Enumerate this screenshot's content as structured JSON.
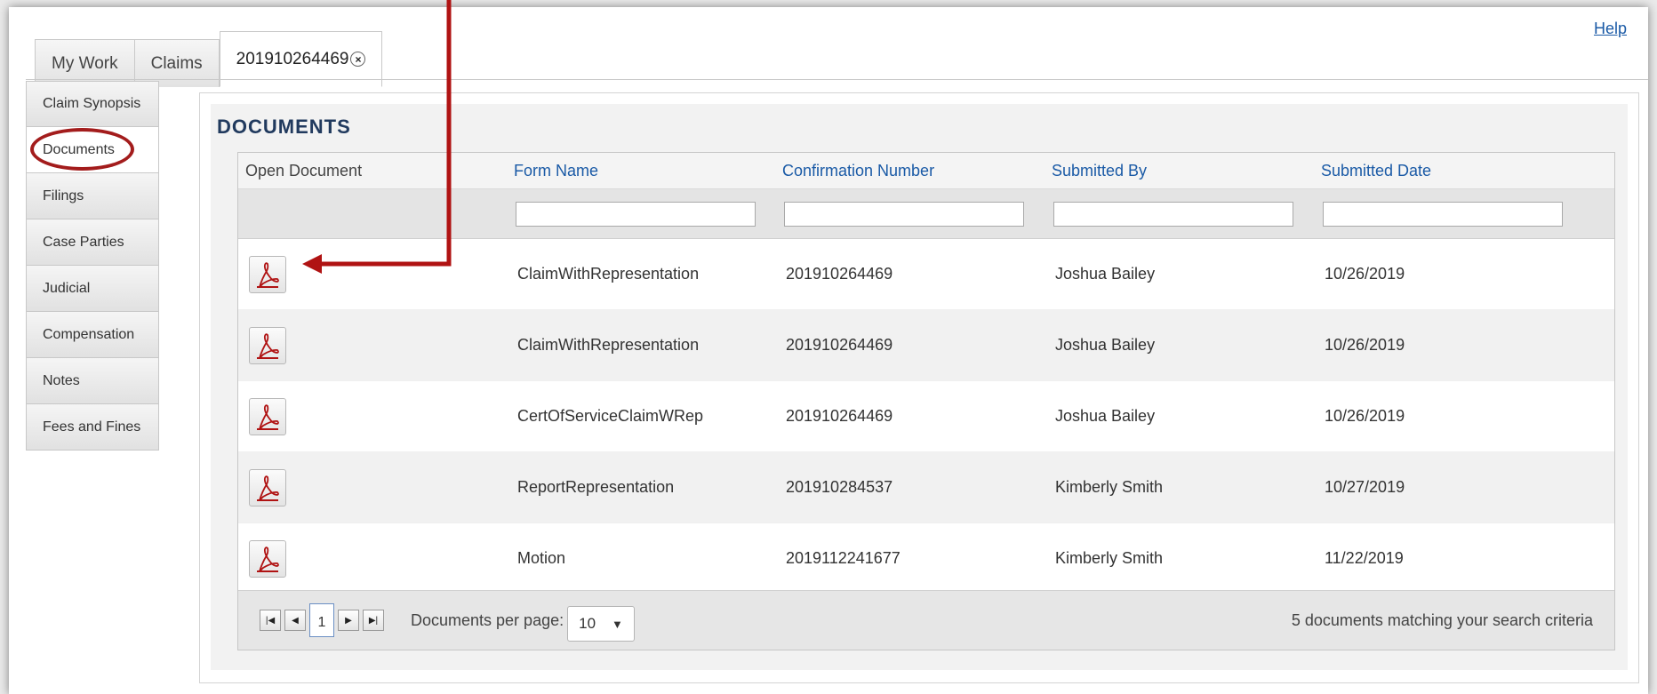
{
  "help": {
    "label": "Help"
  },
  "top_tabs": [
    {
      "label": "My Work"
    },
    {
      "label": "Claims"
    },
    {
      "label": "201910264469"
    }
  ],
  "side_nav": [
    {
      "label": "Claim Synopsis"
    },
    {
      "label": "Documents"
    },
    {
      "label": "Filings"
    },
    {
      "label": "Case Parties"
    },
    {
      "label": "Judicial"
    },
    {
      "label": "Compensation"
    },
    {
      "label": "Notes"
    },
    {
      "label": "Fees and Fines"
    }
  ],
  "documents": {
    "title": "DOCUMENTS",
    "columns": [
      "Open Document",
      "Form Name",
      "Confirmation Number",
      "Submitted By",
      "Submitted Date"
    ],
    "filters": {
      "form_name": "",
      "confirmation_number": "",
      "submitted_by": "",
      "submitted_date": ""
    },
    "rows": [
      {
        "form_name": "ClaimWithRepresentation",
        "confirmation_number": "201910264469",
        "submitted_by": "Joshua Bailey",
        "submitted_date": "10/26/2019"
      },
      {
        "form_name": "ClaimWithRepresentation",
        "confirmation_number": "201910264469",
        "submitted_by": "Joshua Bailey",
        "submitted_date": "10/26/2019"
      },
      {
        "form_name": "CertOfServiceClaimWRep",
        "confirmation_number": "201910264469",
        "submitted_by": "Joshua Bailey",
        "submitted_date": "10/26/2019"
      },
      {
        "form_name": "ReportRepresentation",
        "confirmation_number": "201910284537",
        "submitted_by": "Kimberly Smith",
        "submitted_date": "10/27/2019"
      },
      {
        "form_name": "Motion",
        "confirmation_number": "2019112241677",
        "submitted_by": "Kimberly Smith",
        "submitted_date": "11/22/2019"
      }
    ],
    "pager": {
      "current_page": "1",
      "per_page_label": "Documents per page:",
      "per_page_value": "10",
      "match_text": "5 documents matching your search criteria"
    }
  },
  "colors": {
    "annotation_red": "#b01313",
    "link_blue": "#1a5aa6",
    "title_navy": "#213a5e"
  },
  "icons": {
    "open_document": "pdf-icon",
    "close_tab": "close-icon"
  }
}
